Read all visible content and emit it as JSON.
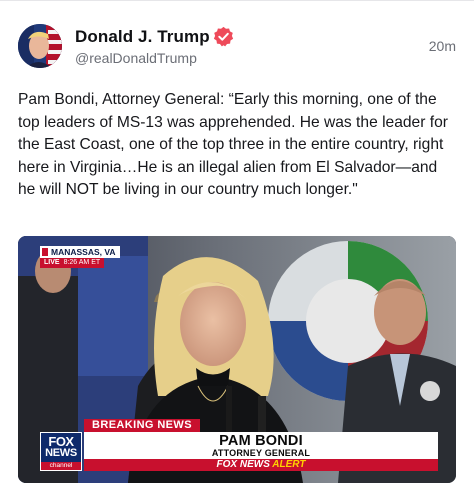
{
  "post": {
    "author_name": "Donald J. Trump",
    "handle": "@realDonaldTrump",
    "timestamp": "20m",
    "text": "Pam Bondi, Attorney General: “Early this morning, one of the top leaders of MS-13 was apprehended. He was the leader for the East Coast, one of the top three in the entire country, right here in Virginia…He is an illegal alien from El Salvador—and he will NOT be living in our country much longer.\""
  },
  "icons": {
    "verified": "verified-badge-icon",
    "avatar": "profile-avatar"
  },
  "colors": {
    "verified_badge": "#ee4a5a",
    "fox_red": "#c8102e",
    "fox_blue": "#0e2a6b",
    "alert_accent": "#ffd200"
  },
  "media": {
    "location": "MANASSAS, VA",
    "live_label": "LIVE",
    "live_time": "8:26 AM ET",
    "breaking": "BREAKING NEWS",
    "chyron_name": "PAM BONDI",
    "chyron_title": "ATTORNEY GENERAL",
    "alert_fox": "FOX NEWS",
    "alert_word": "ALERT",
    "logo_top": "FOX",
    "logo_mid": "NEWS",
    "logo_bottom": "channel"
  }
}
